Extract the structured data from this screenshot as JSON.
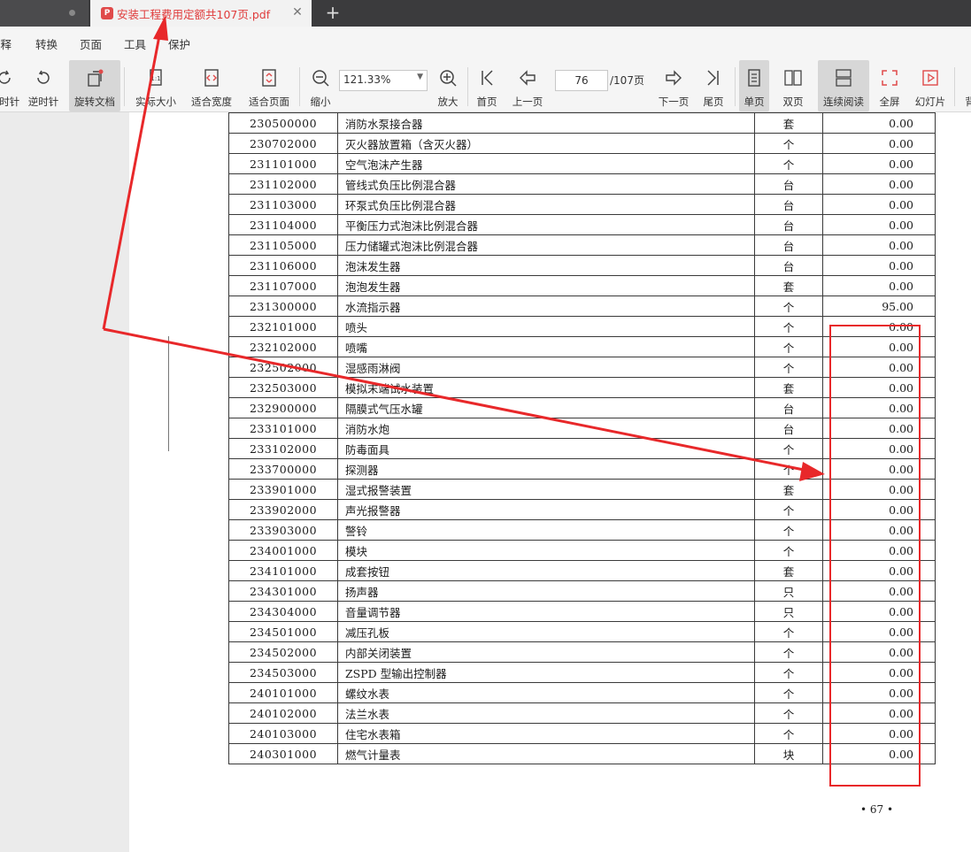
{
  "tabs": {
    "active_title": "安装工程费用定额共107页.pdf",
    "pdf_icon": "pdf-file-icon",
    "new_tab": "+"
  },
  "menu": {
    "items": [
      "注释",
      "转换",
      "页面",
      "工具",
      "保护"
    ]
  },
  "toolbar": {
    "clockwise": "顺时针",
    "counterclockwise": "逆时针",
    "rotate_doc": "旋转文档",
    "actual_size": "实际大小",
    "fit_width": "适合宽度",
    "fit_page": "适合页面",
    "zoom_out": "缩小",
    "zoom_value": "121.33%",
    "zoom_in": "放大",
    "first_page": "首页",
    "prev_page": "上一页",
    "current_page": "76",
    "total_pages": "/107页",
    "next_page": "下一页",
    "last_page": "尾页",
    "single_page": "单页",
    "double_page": "双页",
    "continuous": "连续阅读",
    "fullscreen": "全屏",
    "slideshow": "幻灯片",
    "background": "背"
  },
  "table": {
    "rows": [
      {
        "code": "230500000",
        "name": "消防水泵接合器",
        "unit": "套",
        "price": "0.00"
      },
      {
        "code": "230702000",
        "name": "灭火器放置箱（含灭火器）",
        "unit": "个",
        "price": "0.00"
      },
      {
        "code": "231101000",
        "name": "空气泡沫产生器",
        "unit": "个",
        "price": "0.00"
      },
      {
        "code": "231102000",
        "name": "管线式负压比例混合器",
        "unit": "台",
        "price": "0.00"
      },
      {
        "code": "231103000",
        "name": "环泵式负压比例混合器",
        "unit": "台",
        "price": "0.00"
      },
      {
        "code": "231104000",
        "name": "平衡压力式泡沫比例混合器",
        "unit": "台",
        "price": "0.00"
      },
      {
        "code": "231105000",
        "name": "压力储罐式泡沫比例混合器",
        "unit": "台",
        "price": "0.00"
      },
      {
        "code": "231106000",
        "name": "泡沫发生器",
        "unit": "台",
        "price": "0.00"
      },
      {
        "code": "231107000",
        "name": "泡泡发生器",
        "unit": "套",
        "price": "0.00"
      },
      {
        "code": "231300000",
        "name": "水流指示器",
        "unit": "个",
        "price": "95.00"
      },
      {
        "code": "232101000",
        "name": "喷头",
        "unit": "个",
        "price": "0.00"
      },
      {
        "code": "232102000",
        "name": "喷嘴",
        "unit": "个",
        "price": "0.00"
      },
      {
        "code": "232502000",
        "name": "湿感雨淋阀",
        "unit": "个",
        "price": "0.00"
      },
      {
        "code": "232503000",
        "name": "模拟末端试水装置",
        "unit": "套",
        "price": "0.00"
      },
      {
        "code": "232900000",
        "name": "隔膜式气压水罐",
        "unit": "台",
        "price": "0.00"
      },
      {
        "code": "233101000",
        "name": "消防水炮",
        "unit": "台",
        "price": "0.00"
      },
      {
        "code": "233102000",
        "name": "防毒面具",
        "unit": "个",
        "price": "0.00"
      },
      {
        "code": "233700000",
        "name": "探测器",
        "unit": "个",
        "price": "0.00"
      },
      {
        "code": "233901000",
        "name": "湿式报警装置",
        "unit": "套",
        "price": "0.00"
      },
      {
        "code": "233902000",
        "name": "声光报警器",
        "unit": "个",
        "price": "0.00"
      },
      {
        "code": "233903000",
        "name": "警铃",
        "unit": "个",
        "price": "0.00"
      },
      {
        "code": "234001000",
        "name": "模块",
        "unit": "个",
        "price": "0.00"
      },
      {
        "code": "234101000",
        "name": "成套按钮",
        "unit": "套",
        "price": "0.00"
      },
      {
        "code": "234301000",
        "name": "扬声器",
        "unit": "只",
        "price": "0.00"
      },
      {
        "code": "234304000",
        "name": "音量调节器",
        "unit": "只",
        "price": "0.00"
      },
      {
        "code": "234501000",
        "name": "减压孔板",
        "unit": "个",
        "price": "0.00"
      },
      {
        "code": "234502000",
        "name": "内部关闭装置",
        "unit": "个",
        "price": "0.00"
      },
      {
        "code": "234503000",
        "name": "ZSPD 型输出控制器",
        "unit": "个",
        "price": "0.00"
      },
      {
        "code": "240101000",
        "name": "螺纹水表",
        "unit": "个",
        "price": "0.00"
      },
      {
        "code": "240102000",
        "name": "法兰水表",
        "unit": "个",
        "price": "0.00"
      },
      {
        "code": "240103000",
        "name": "住宅水表箱",
        "unit": "个",
        "price": "0.00"
      },
      {
        "code": "240301000",
        "name": "燃气计量表",
        "unit": "块",
        "price": "0.00"
      }
    ]
  },
  "page_number": "• 67 •",
  "colors": {
    "accent_red": "#e8282a",
    "tab_title_red": "#e03c3c",
    "tabbar_bg": "#3b3b3d"
  }
}
